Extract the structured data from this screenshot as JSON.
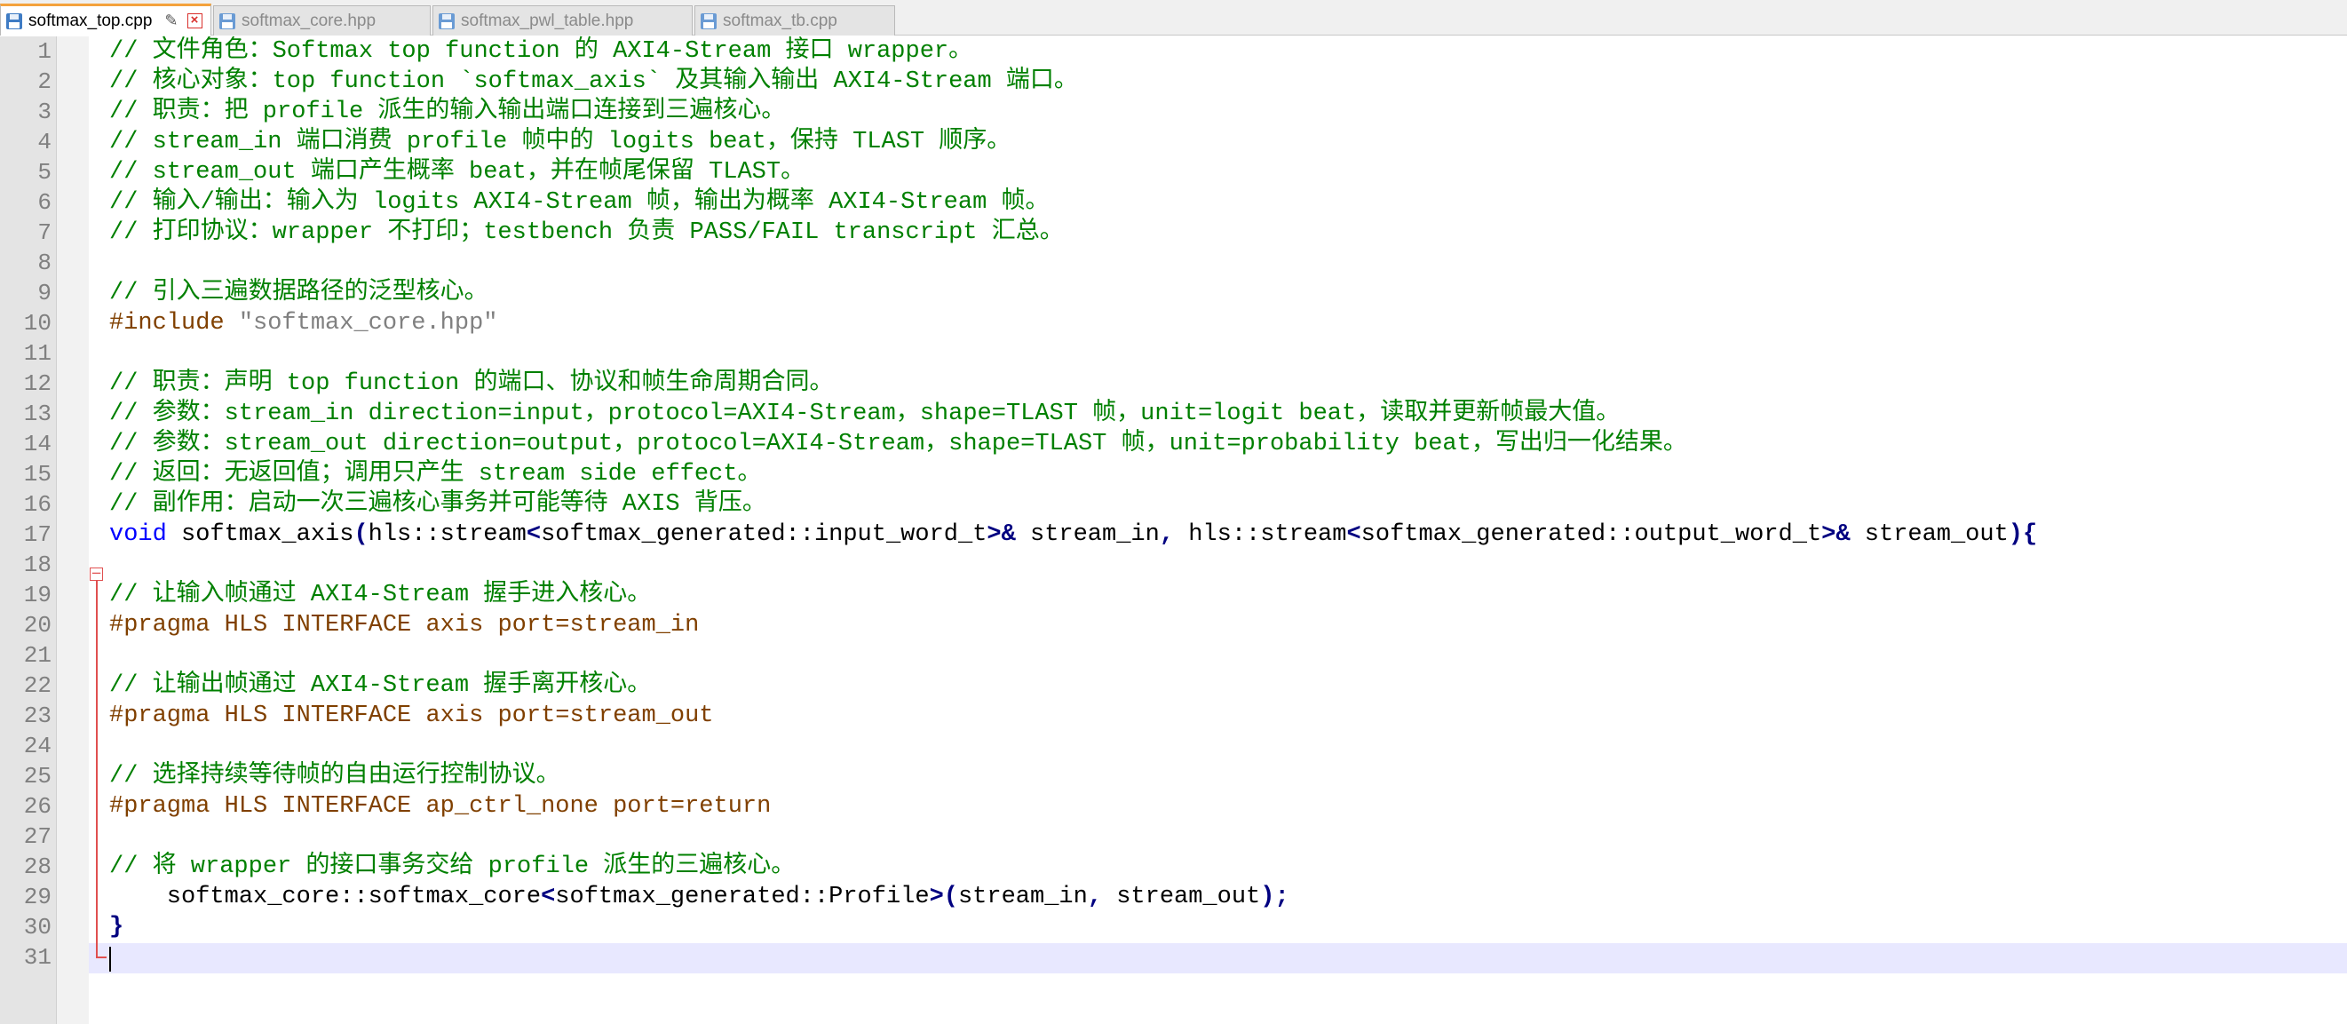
{
  "tabs": [
    {
      "label": "softmax_top.cpp",
      "active": true,
      "pin_icon": "pin-icon",
      "close_icon": "close-icon"
    },
    {
      "label": "softmax_core.hpp",
      "active": false
    },
    {
      "label": "softmax_pwl_table.hpp",
      "active": false
    },
    {
      "label": "softmax_tb.cpp",
      "active": false
    }
  ],
  "colors": {
    "comment": "#008000",
    "preprocessor": "#804000",
    "string": "#808080",
    "keyword": "#0000ff",
    "operator": "#000080",
    "active_tab_accent": "#f4a23c",
    "current_line": "#e8e8ff"
  },
  "lines": [
    {
      "num": "1",
      "tokens": [
        {
          "t": "// 文件角色：Softmax top function 的 AXI4-Stream 接口 wrapper。",
          "c": "comment"
        }
      ]
    },
    {
      "num": "2",
      "tokens": [
        {
          "t": "// 核心对象：top function `softmax_axis` 及其输入输出 AXI4-Stream 端口。",
          "c": "comment"
        }
      ]
    },
    {
      "num": "3",
      "tokens": [
        {
          "t": "// 职责：把 profile 派生的输入输出端口连接到三遍核心。",
          "c": "comment"
        }
      ]
    },
    {
      "num": "4",
      "tokens": [
        {
          "t": "// stream_in 端口消费 profile 帧中的 logits beat，保持 TLAST 顺序。",
          "c": "comment"
        }
      ]
    },
    {
      "num": "5",
      "tokens": [
        {
          "t": "// stream_out 端口产生概率 beat，并在帧尾保留 TLAST。",
          "c": "comment"
        }
      ]
    },
    {
      "num": "6",
      "tokens": [
        {
          "t": "// 输入/输出：输入为 logits AXI4-Stream 帧，输出为概率 AXI4-Stream 帧。",
          "c": "comment"
        }
      ]
    },
    {
      "num": "7",
      "tokens": [
        {
          "t": "// 打印协议：wrapper 不打印；testbench 负责 PASS/FAIL transcript 汇总。",
          "c": "comment"
        }
      ]
    },
    {
      "num": "8",
      "tokens": []
    },
    {
      "num": "9",
      "tokens": [
        {
          "t": "// 引入三遍数据路径的泛型核心。",
          "c": "comment"
        }
      ]
    },
    {
      "num": "10",
      "tokens": [
        {
          "t": "#include ",
          "c": "preproc"
        },
        {
          "t": "\"softmax_core.hpp\"",
          "c": "string"
        }
      ]
    },
    {
      "num": "11",
      "tokens": []
    },
    {
      "num": "12",
      "tokens": [
        {
          "t": "// 职责：声明 top function 的端口、协议和帧生命周期合同。",
          "c": "comment"
        }
      ]
    },
    {
      "num": "13",
      "tokens": [
        {
          "t": "// 参数：stream_in direction=input，protocol=AXI4-Stream，shape=TLAST 帧，unit=logit beat，读取并更新帧最大值。",
          "c": "comment"
        }
      ]
    },
    {
      "num": "14",
      "tokens": [
        {
          "t": "// 参数：stream_out direction=output，protocol=AXI4-Stream，shape=TLAST 帧，unit=probability beat，写出归一化结果。",
          "c": "comment"
        }
      ]
    },
    {
      "num": "15",
      "tokens": [
        {
          "t": "// 返回：无返回值；调用只产生 stream side effect。",
          "c": "comment"
        }
      ]
    },
    {
      "num": "16",
      "tokens": [
        {
          "t": "// 副作用：启动一次三遍核心事务并可能等待 AXIS 背压。",
          "c": "comment"
        }
      ]
    },
    {
      "num": "17",
      "tokens": [
        {
          "t": "void",
          "c": "kw"
        },
        {
          "t": " softmax_axis",
          "c": "plain"
        },
        {
          "t": "(",
          "c": "op"
        },
        {
          "t": "hls::stream",
          "c": "plain"
        },
        {
          "t": "<",
          "c": "op"
        },
        {
          "t": "softmax_generated::input_word_t",
          "c": "plain"
        },
        {
          "t": ">&",
          "c": "op"
        },
        {
          "t": " stream_in",
          "c": "plain"
        },
        {
          "t": ",",
          "c": "op"
        },
        {
          "t": " hls::stream",
          "c": "plain"
        },
        {
          "t": "<",
          "c": "op"
        },
        {
          "t": "softmax_generated::output_word_t",
          "c": "plain"
        },
        {
          "t": ">&",
          "c": "op"
        },
        {
          "t": " stream_out",
          "c": "plain"
        },
        {
          "t": "){",
          "c": "op"
        }
      ]
    },
    {
      "num": "18",
      "tokens": []
    },
    {
      "num": "19",
      "tokens": [
        {
          "t": "// 让输入帧通过 AXI4-Stream 握手进入核心。",
          "c": "comment"
        }
      ]
    },
    {
      "num": "20",
      "tokens": [
        {
          "t": "#pragma HLS INTERFACE axis port=stream_in",
          "c": "preproc"
        }
      ]
    },
    {
      "num": "21",
      "tokens": []
    },
    {
      "num": "22",
      "tokens": [
        {
          "t": "// 让输出帧通过 AXI4-Stream 握手离开核心。",
          "c": "comment"
        }
      ]
    },
    {
      "num": "23",
      "tokens": [
        {
          "t": "#pragma HLS INTERFACE axis port=stream_out",
          "c": "preproc"
        }
      ]
    },
    {
      "num": "24",
      "tokens": []
    },
    {
      "num": "25",
      "tokens": [
        {
          "t": "// 选择持续等待帧的自由运行控制协议。",
          "c": "comment"
        }
      ]
    },
    {
      "num": "26",
      "tokens": [
        {
          "t": "#pragma HLS INTERFACE ap_ctrl_none port=return",
          "c": "preproc"
        }
      ]
    },
    {
      "num": "27",
      "tokens": []
    },
    {
      "num": "28",
      "tokens": [
        {
          "t": "// 将 wrapper 的接口事务交给 profile 派生的三遍核心。",
          "c": "comment"
        }
      ]
    },
    {
      "num": "29",
      "tokens": [
        {
          "t": "    softmax_core::softmax_core",
          "c": "plain"
        },
        {
          "t": "<",
          "c": "op"
        },
        {
          "t": "softmax_generated::Profile",
          "c": "plain"
        },
        {
          "t": ">(",
          "c": "op"
        },
        {
          "t": "stream_in",
          "c": "plain"
        },
        {
          "t": ",",
          "c": "op"
        },
        {
          "t": " stream_out",
          "c": "plain"
        },
        {
          "t": ");",
          "c": "op"
        }
      ]
    },
    {
      "num": "30",
      "tokens": [
        {
          "t": "}",
          "c": "op"
        }
      ]
    },
    {
      "num": "31",
      "tokens": []
    }
  ]
}
